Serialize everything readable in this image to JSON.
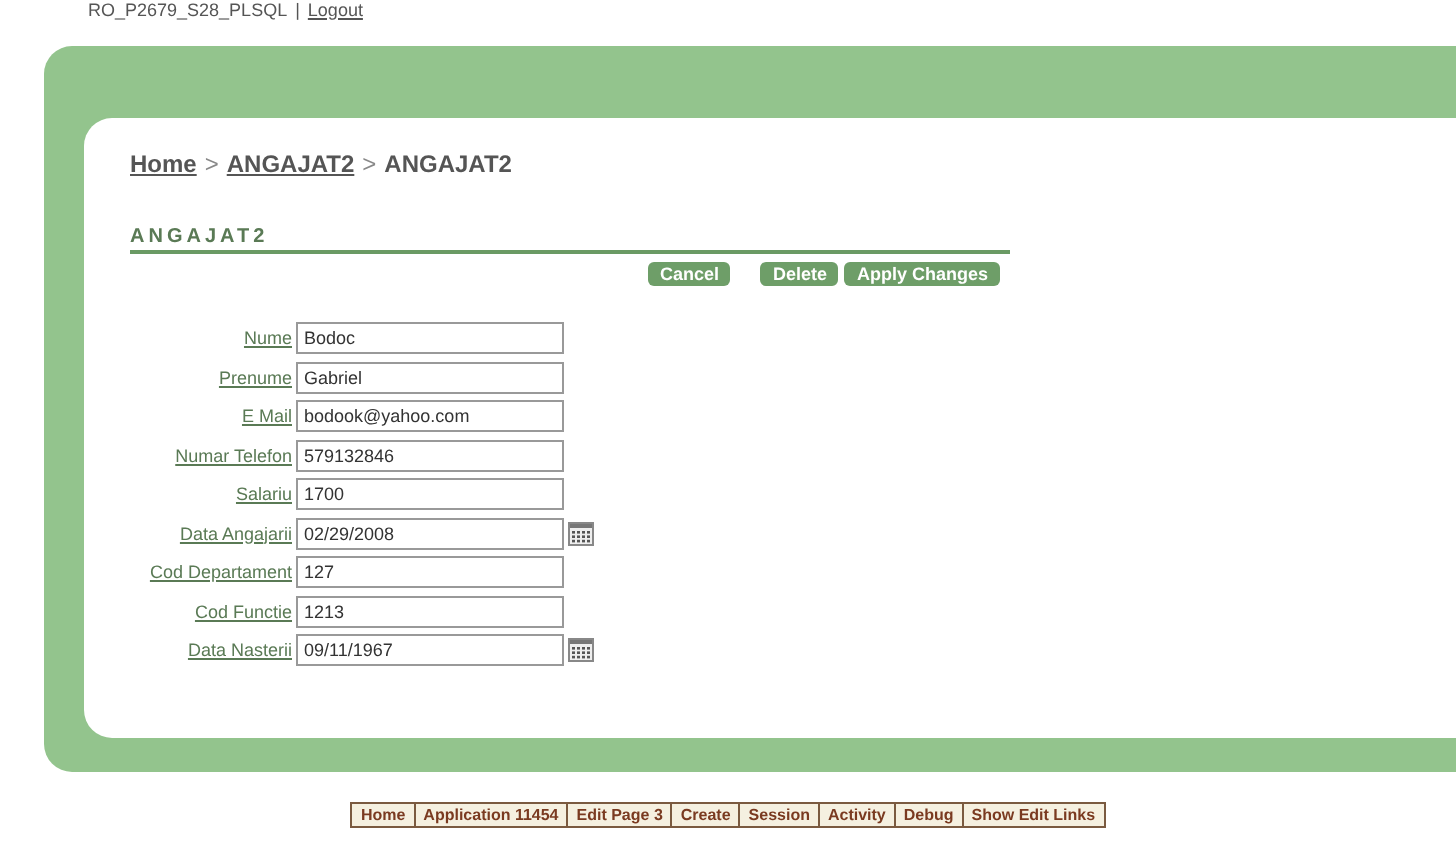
{
  "user_bar": {
    "user": "RO_P2679_S28_PLSQL",
    "separator": "|",
    "logout": "Logout"
  },
  "breadcrumb": [
    {
      "label": "Home",
      "link": true
    },
    {
      "label": "ANGAJAT2",
      "link": true
    },
    {
      "label": "ANGAJAT2",
      "link": false
    }
  ],
  "breadcrumb_separator": ">",
  "region": {
    "title": "ANGAJAT2"
  },
  "buttons": [
    {
      "label": "Cancel"
    },
    {
      "label": "Delete"
    },
    {
      "label": "Apply Changes"
    }
  ],
  "fields": [
    {
      "label": "Nume",
      "value": "Bodoc",
      "kind": "text"
    },
    {
      "label": "Prenume",
      "value": "Gabriel",
      "kind": "text"
    },
    {
      "label": "E Mail",
      "value": "bodook@yahoo.com",
      "kind": "text"
    },
    {
      "label": "Numar Telefon",
      "value": "579132846",
      "kind": "text"
    },
    {
      "label": "Salariu",
      "value": "1700",
      "kind": "text"
    },
    {
      "label": "Data Angajarii",
      "value": "02/29/2008",
      "kind": "date"
    },
    {
      "label": "Cod Departament",
      "value": "127",
      "kind": "text"
    },
    {
      "label": "Cod Functie",
      "value": "1213",
      "kind": "text"
    },
    {
      "label": "Data Nasterii",
      "value": "09/11/1967",
      "kind": "date"
    }
  ],
  "developer_toolbar": [
    "Home",
    "Application 11454",
    "Edit Page 3",
    "Create",
    "Session",
    "Activity",
    "Debug",
    "Show Edit Links"
  ]
}
